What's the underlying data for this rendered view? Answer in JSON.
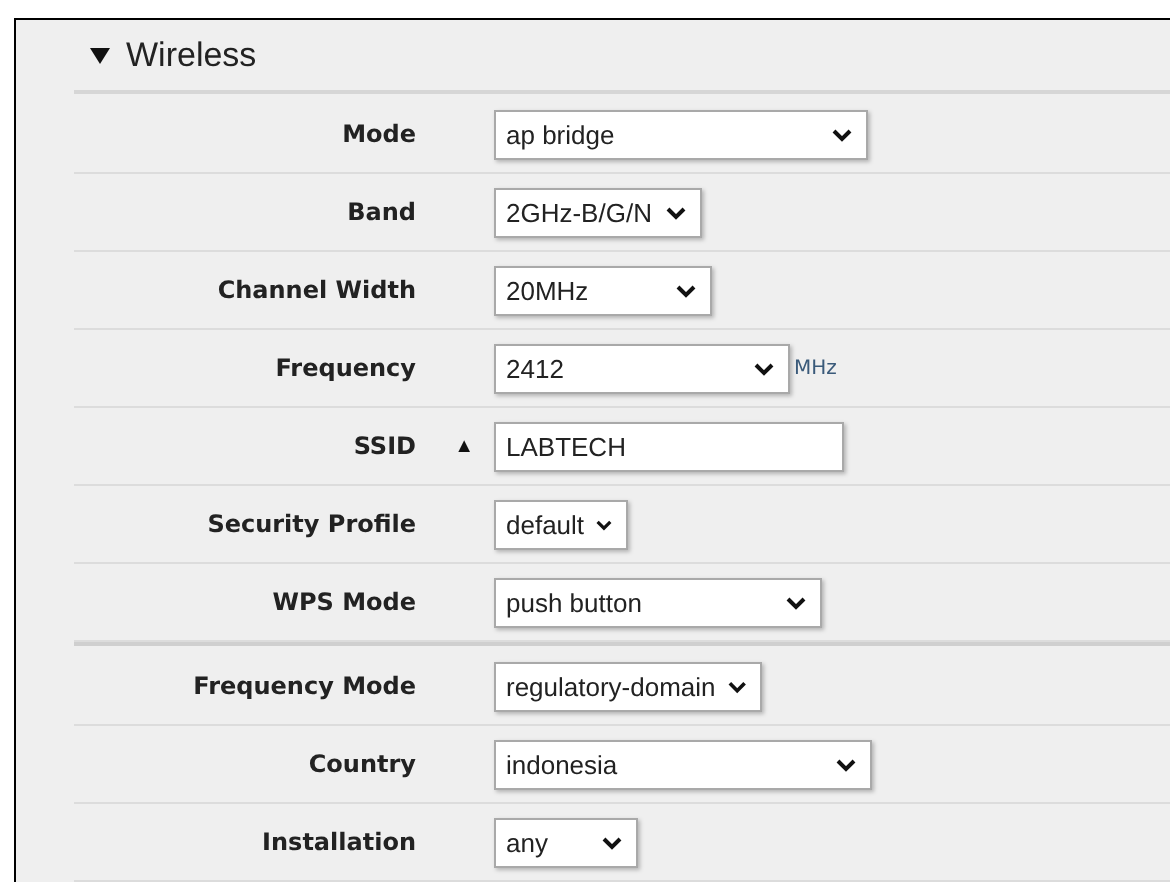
{
  "section": {
    "title": "Wireless",
    "expanded": true,
    "groups": [
      {
        "rows": [
          {
            "label": "Mode",
            "kind": "select",
            "value": "ap bridge"
          },
          {
            "label": "Band",
            "kind": "select",
            "value": "2GHz-B/G/N"
          },
          {
            "label": "Channel Width",
            "kind": "select",
            "value": "20MHz"
          },
          {
            "label": "Frequency",
            "kind": "select",
            "value": "2412",
            "unit": "MHz"
          },
          {
            "label": "SSID",
            "kind": "text",
            "value": "LABTECH",
            "toggle": "▲"
          },
          {
            "label": "Security Profile",
            "kind": "select",
            "value": "default"
          },
          {
            "label": "WPS Mode",
            "kind": "select",
            "value": "push button"
          }
        ]
      },
      {
        "rows": [
          {
            "label": "Frequency Mode",
            "kind": "select",
            "value": "regulatory-domain"
          },
          {
            "label": "Country",
            "kind": "select",
            "value": "indonesia"
          },
          {
            "label": "Installation",
            "kind": "select",
            "value": "any"
          }
        ]
      }
    ]
  }
}
